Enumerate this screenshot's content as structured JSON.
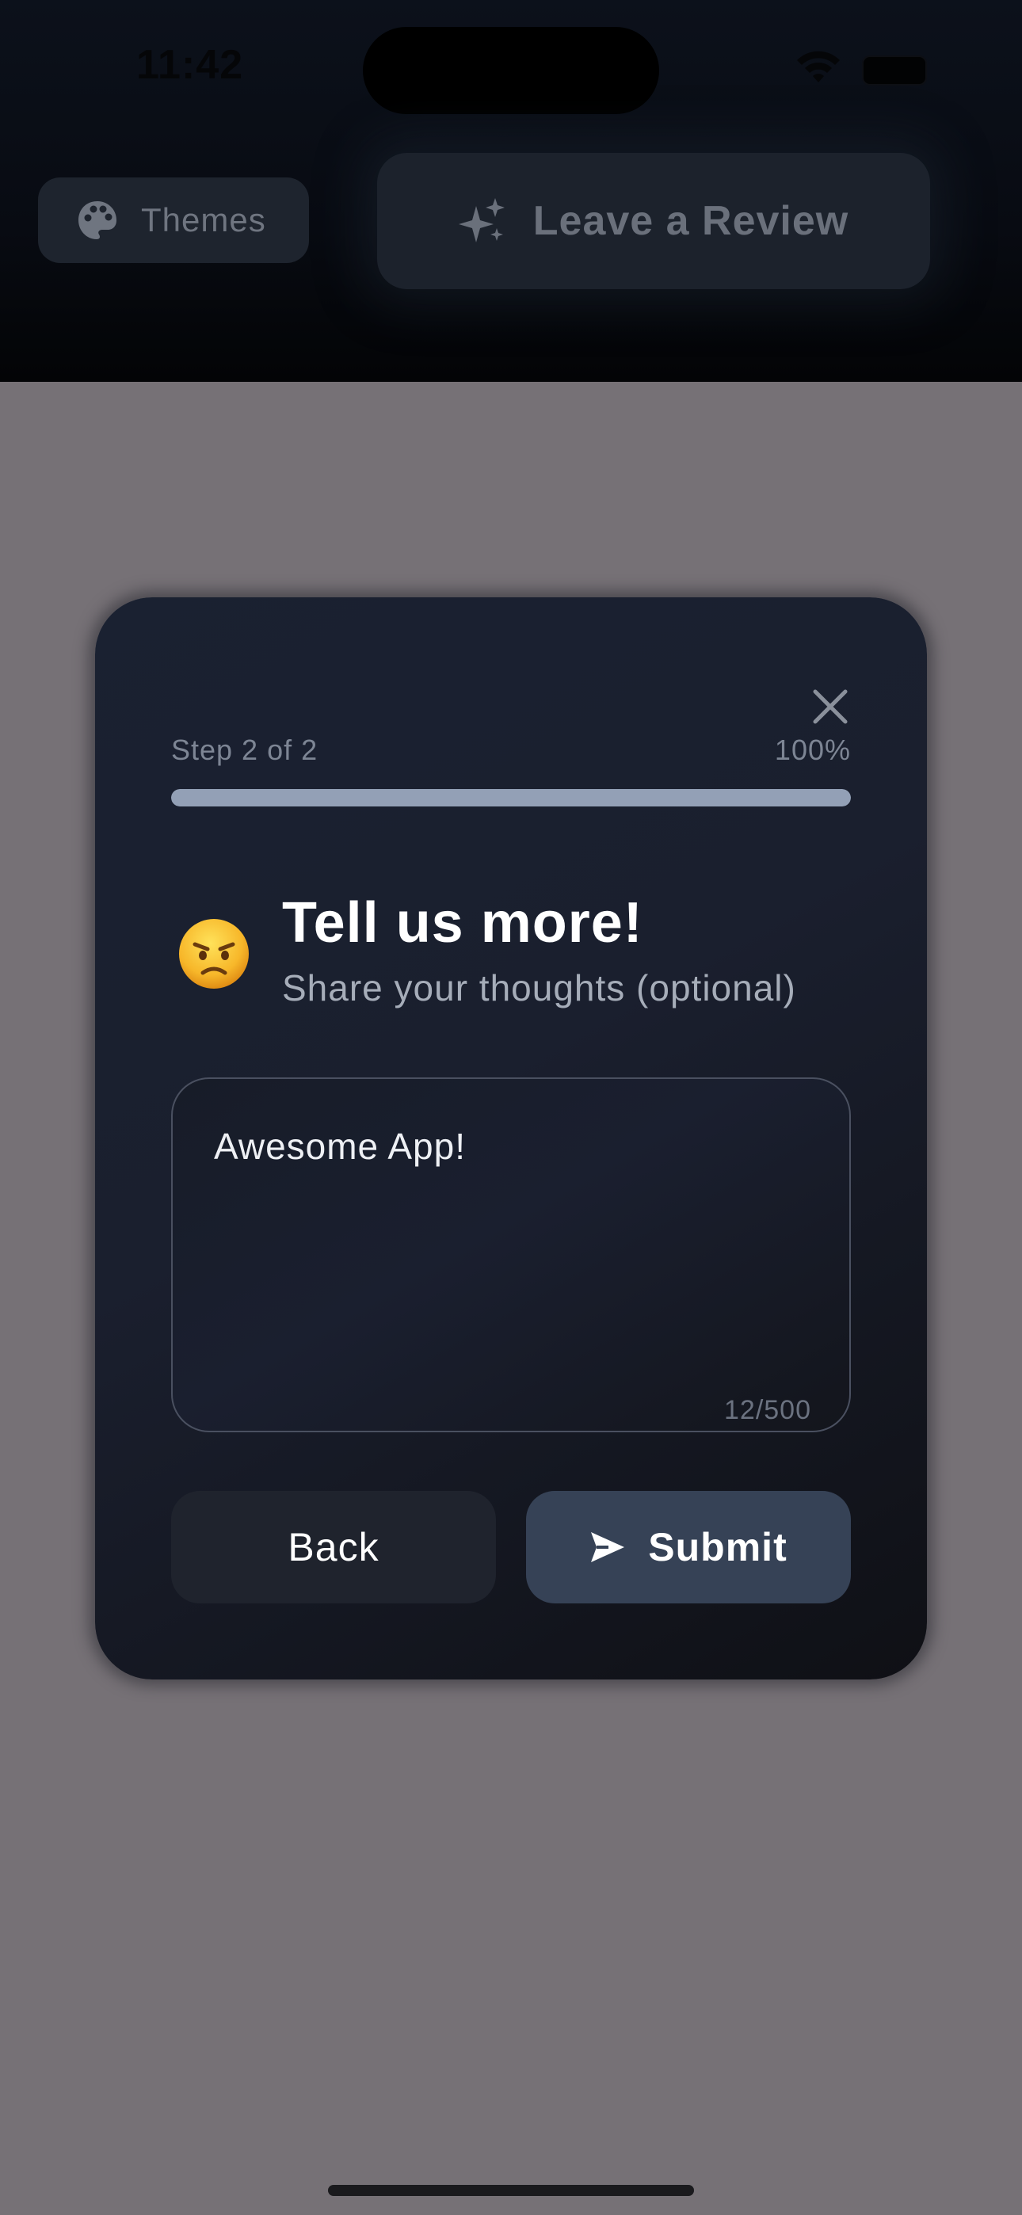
{
  "status_bar": {
    "time": "11:42"
  },
  "header": {
    "themes_label": "Themes",
    "themes_icon": "palette-icon",
    "review_label": "Leave a Review",
    "review_icon": "sparkles-icon"
  },
  "modal": {
    "step_label": "Step 2 of 2",
    "progress_label": "100%",
    "progress_fraction": 1.0,
    "emoji": "😠",
    "title": "Tell us more!",
    "subtitle": "Share your thoughts (optional)",
    "feedback_value": "Awesome App!",
    "char_count": "12/500",
    "back_label": "Back",
    "submit_label": "Submit",
    "submit_icon": "send-icon",
    "close_icon": "close-icon"
  },
  "colors": {
    "backdrop": "#767176",
    "card": "#1a2131",
    "progress_fill": "#93a0b6",
    "submit_bg": "#364256",
    "back_bg": "#1f232d"
  }
}
